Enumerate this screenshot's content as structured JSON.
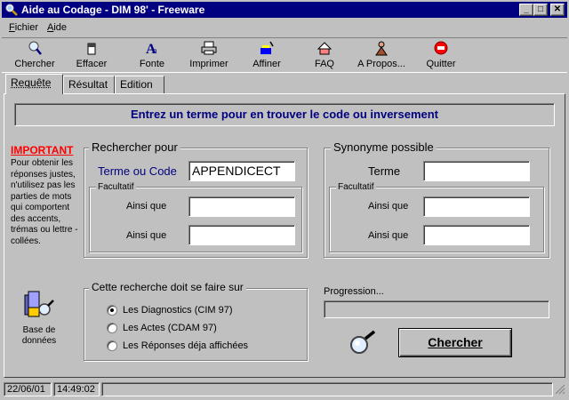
{
  "window": {
    "title": "Aide au Codage - DIM 98' - Freeware",
    "minimize": "_",
    "maximize": "□",
    "close": "✕"
  },
  "menu": [
    {
      "label_u": "F",
      "label_rest": "ichier"
    },
    {
      "label_u": "A",
      "label_rest": "ide"
    }
  ],
  "toolbar": [
    {
      "label": "Chercher",
      "icon": "magnifier-icon"
    },
    {
      "label": "Effacer",
      "icon": "eraser-icon"
    },
    {
      "label": "Fonte",
      "icon": "font-icon"
    },
    {
      "label": "Imprimer",
      "icon": "printer-icon"
    },
    {
      "label": "Affiner",
      "icon": "refine-icon"
    },
    {
      "label": "FAQ",
      "icon": "faq-icon"
    },
    {
      "label": "A Propos...",
      "icon": "about-icon"
    },
    {
      "label": "Quitter",
      "icon": "quit-icon"
    }
  ],
  "tabs": [
    "Requête",
    "Résultat",
    "Edition"
  ],
  "banner": "Entrez un terme pour en trouver le code ou inversement",
  "important": {
    "title": "IMPORTANT",
    "text": "Pour obtenir les réponses justes, n'utilisez pas les parties de mots qui comportent des accents, trémas ou lettre -collées."
  },
  "search_group": {
    "title": "Rechercher pour",
    "term_label": "Terme ou Code",
    "term_value": "APPENDICECT",
    "optional_title": "Facultatif",
    "also1_label": "Ainsi que",
    "also1_value": "",
    "also2_label": "Ainsi que",
    "also2_value": ""
  },
  "synonym_group": {
    "title": "Synonyme possible",
    "term_label": "Terme",
    "term_value": "",
    "optional_title": "Facultatif",
    "also1_label": "Ainsi que",
    "also1_value": "",
    "also2_label": "Ainsi que",
    "also2_value": ""
  },
  "database": {
    "label_line1": "Base de",
    "label_line2": "données"
  },
  "scope_group": {
    "title": "Cette recherche doit se faire sur",
    "options": [
      {
        "label": "Les Diagnostics (CIM 97)",
        "selected": true
      },
      {
        "label": "Les Actes (CDAM 97)",
        "selected": false
      },
      {
        "label": "Les Réponses déja affichées",
        "selected": false
      }
    ]
  },
  "progress": {
    "label": "Progression...",
    "value": 0
  },
  "search_button": "Chercher",
  "status": {
    "date": "22/06/01",
    "time": "14:49:02"
  }
}
